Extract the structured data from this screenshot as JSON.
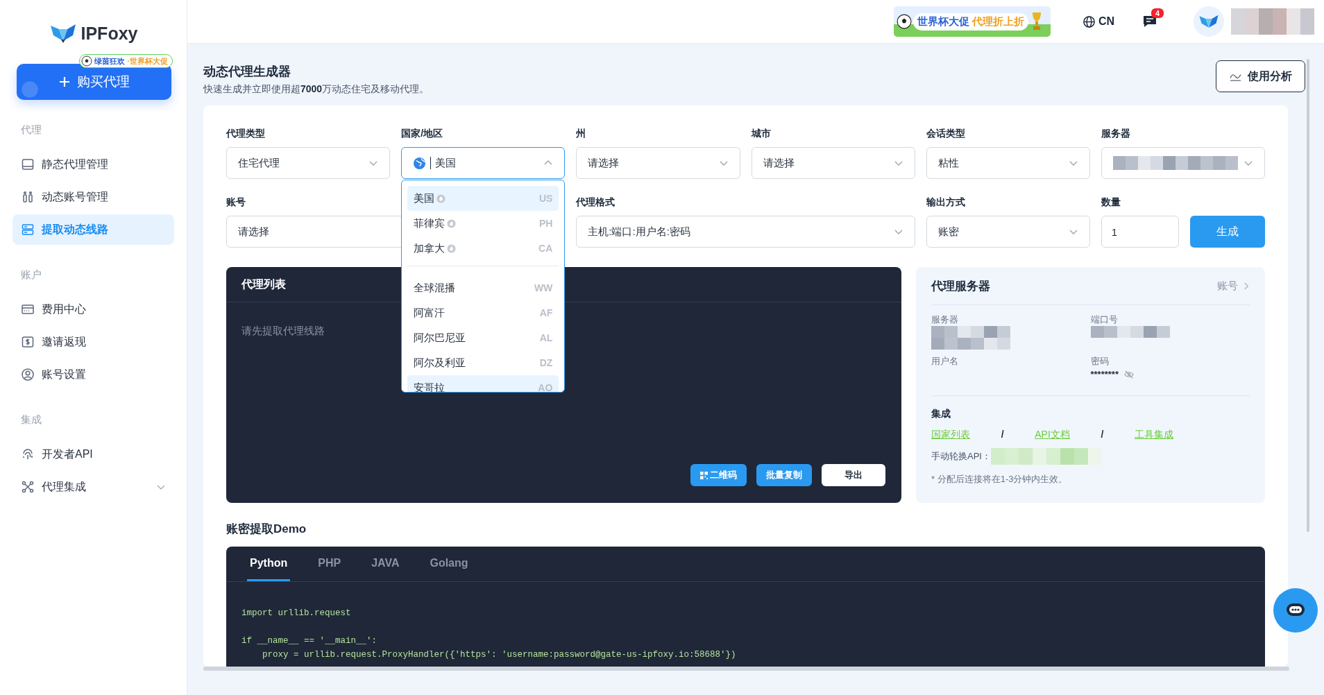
{
  "sidebar": {
    "logo": "IPFoxy",
    "buy_button": {
      "label": "购买代理",
      "promo": [
        "绿茵狂欢",
        "·世界杯大促"
      ]
    },
    "groups": [
      {
        "title": "代理",
        "items": [
          {
            "label": "静态代理管理",
            "selected": false
          },
          {
            "label": "动态账号管理",
            "selected": false
          },
          {
            "label": "提取动态线路",
            "selected": true
          }
        ]
      },
      {
        "title": "账户",
        "items": [
          {
            "label": "费用中心",
            "selected": false
          },
          {
            "label": "邀请返现",
            "selected": false
          },
          {
            "label": "账号设置",
            "selected": false
          }
        ]
      },
      {
        "title": "集成",
        "items": [
          {
            "label": "开发者API",
            "selected": false
          },
          {
            "label": "代理集成",
            "selected": false,
            "expanded": false
          }
        ]
      }
    ]
  },
  "header": {
    "banner": [
      "世界杯大促",
      "代理折上折"
    ],
    "language": "CN",
    "message_count": "4",
    "user_redacted": true
  },
  "page": {
    "title": "动态代理生成器",
    "subtitle": "快速生成并立即使用超**7000**万动态住宅及移动代理。",
    "analysis_button": "使用分析"
  },
  "form": {
    "row1": [
      {
        "label": "代理类型",
        "kind": "select",
        "value": "住宅代理"
      },
      {
        "label": "国家/地区",
        "kind": "country",
        "value": "美国",
        "open": true
      },
      {
        "label": "州",
        "kind": "select",
        "value": "请选择"
      },
      {
        "label": "城市",
        "kind": "select",
        "value": "请选择"
      },
      {
        "label": "会话类型",
        "kind": "select",
        "value": "粘性"
      },
      {
        "label": "服务器",
        "kind": "redacted"
      }
    ],
    "row2": [
      {
        "label": "账号",
        "kind": "select",
        "value": "请选择"
      },
      {
        "label": "代理格式",
        "kind": "select",
        "value": "主机:端口:用户名:密码"
      },
      {
        "label": "输出方式",
        "kind": "select",
        "value": "账密"
      },
      {
        "label": "数量",
        "kind": "input",
        "value": "1"
      }
    ],
    "generate_button": "生成",
    "country_dropdown": [
      {
        "name": "美国",
        "code": "US",
        "hot": true,
        "selected": true,
        "hovered": false
      },
      {
        "name": "菲律宾",
        "code": "PH",
        "hot": true,
        "selected": false,
        "hovered": false
      },
      {
        "name": "加拿大",
        "code": "CA",
        "hot": true,
        "selected": false,
        "hovered": false
      },
      {
        "name": "全球混播",
        "code": "WW",
        "hot": false,
        "selected": false,
        "hovered": false
      },
      {
        "name": "阿富汗",
        "code": "AF",
        "hot": false,
        "selected": false,
        "hovered": false
      },
      {
        "name": "阿尔巴尼亚",
        "code": "AL",
        "hot": false,
        "selected": false,
        "hovered": false
      },
      {
        "name": "阿尔及利亚",
        "code": "DZ",
        "hot": false,
        "selected": false,
        "hovered": false
      },
      {
        "name": "安哥拉",
        "code": "AO",
        "hot": false,
        "selected": false,
        "hovered": true
      }
    ]
  },
  "proxy_list": {
    "title": "代理列表",
    "empty_text": "请先提取代理线路",
    "buttons": [
      {
        "label": "二维码",
        "kind": "primary"
      },
      {
        "label": "批量复制",
        "kind": "primary"
      },
      {
        "label": "导出",
        "kind": "outline"
      }
    ]
  },
  "server_panel": {
    "title": "代理服务器",
    "account_link": "账号",
    "fields": [
      {
        "label": "服务器",
        "redacted": true
      },
      {
        "label": "端口号",
        "redacted": true
      },
      {
        "label": "用户名",
        "redacted": false
      },
      {
        "label": "密码",
        "redacted": false,
        "value": "********"
      }
    ],
    "integration_title": "集成",
    "links": [
      "国家列表",
      "API文档",
      "工具集成"
    ],
    "separators": [
      "/",
      "/"
    ],
    "manual_api_label": "手动轮换API：",
    "note": "* 分配后连接将在1-3分钟内生效。"
  },
  "demo": {
    "title": "账密提取Demo",
    "tabs": [
      {
        "label": "Python",
        "selected": true
      },
      {
        "label": "PHP",
        "selected": false
      },
      {
        "label": "JAVA",
        "selected": false
      },
      {
        "label": "Golang",
        "selected": false
      }
    ],
    "code": "import urllib.request\n\nif __name__ == '__main__':\n    proxy = urllib.request.ProxyHandler({'https': 'username:password@gate-us-ipfoxy.io:58688'})"
  }
}
